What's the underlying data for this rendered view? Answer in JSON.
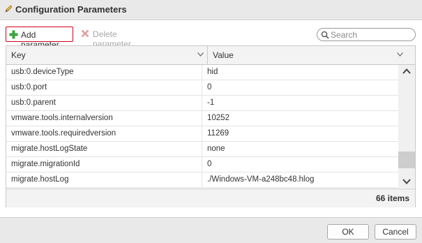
{
  "dialog": {
    "title": "Configuration Parameters"
  },
  "toolbar": {
    "add_label": "Add parameter",
    "delete_label": "Delete parameter",
    "search_placeholder": "Search"
  },
  "grid": {
    "columns": [
      "Key",
      "Value"
    ],
    "rows": [
      {
        "key": "usb:0.deviceType",
        "value": "hid"
      },
      {
        "key": "usb:0.port",
        "value": "0"
      },
      {
        "key": "usb:0.parent",
        "value": "-1"
      },
      {
        "key": "vmware.tools.internalversion",
        "value": "10252"
      },
      {
        "key": "vmware.tools.requiredversion",
        "value": "11269"
      },
      {
        "key": "migrate.hostLogState",
        "value": "none"
      },
      {
        "key": "migrate.migrationId",
        "value": "0"
      },
      {
        "key": "migrate.hostLog",
        "value": "./Windows-VM-a248bc48.hlog"
      }
    ],
    "item_count": "66 items",
    "scroll_position": 0.9
  },
  "buttons": {
    "ok": "OK",
    "cancel": "Cancel"
  },
  "colors": {
    "highlight_border": "#d0021b",
    "add_icon": "#3aa53a",
    "delete_icon": "#e0a0a0"
  }
}
